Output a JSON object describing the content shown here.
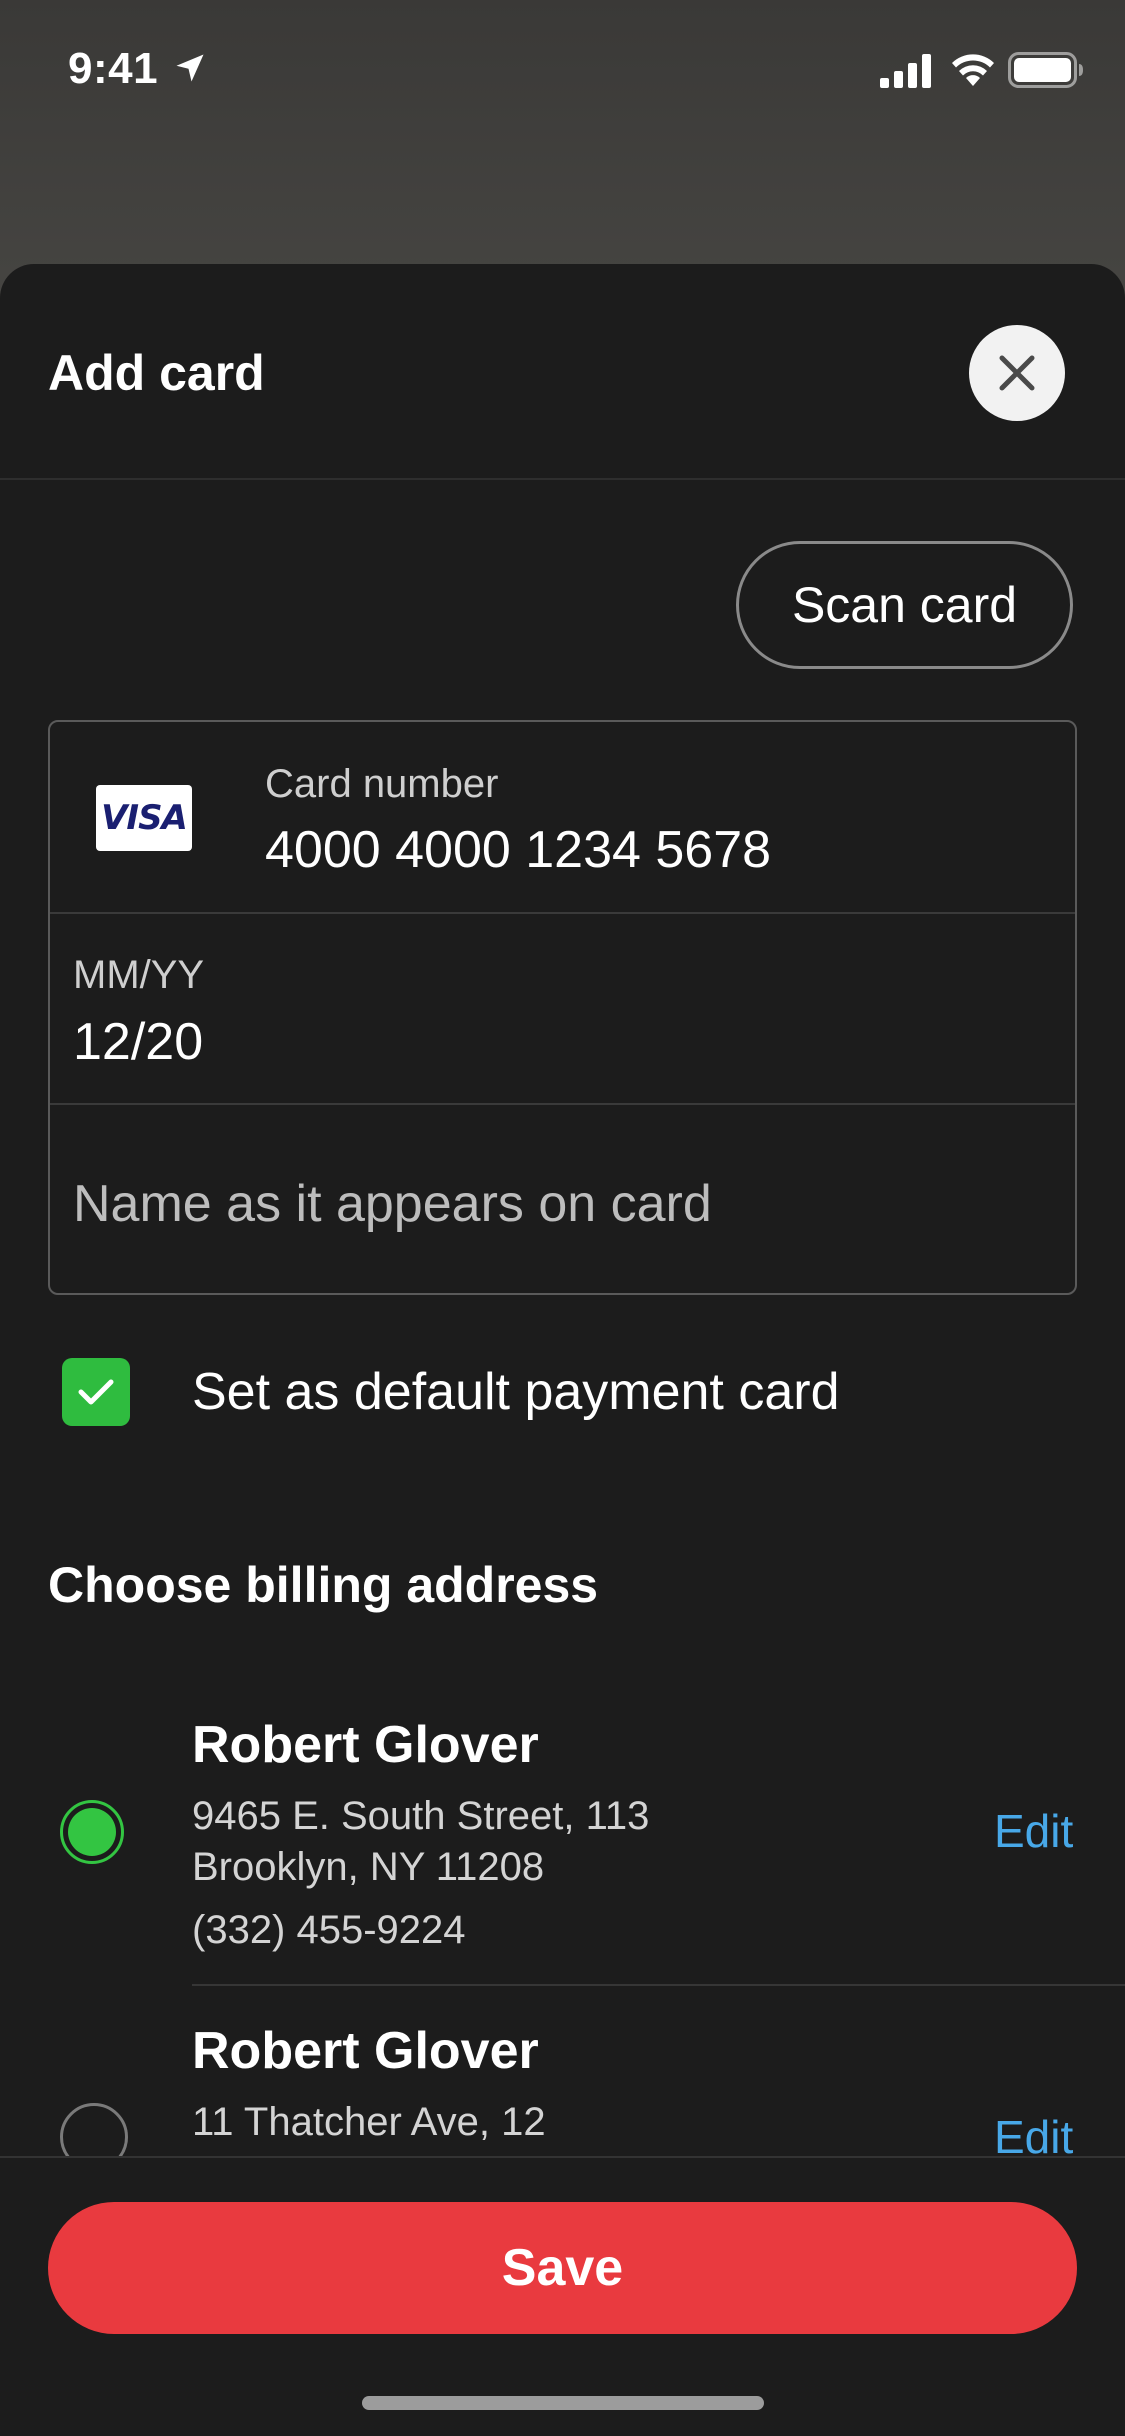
{
  "status_bar": {
    "time": "9:41"
  },
  "sheet": {
    "title": "Add card"
  },
  "scan_card": {
    "label": "Scan card"
  },
  "card_form": {
    "brand": "VISA",
    "card_number_label": "Card number",
    "card_number_value": "4000 4000 1234 5678",
    "expiry_label": "MM/YY",
    "expiry_value": "12/20",
    "name_placeholder": "Name as it appears on card"
  },
  "default_card": {
    "label": "Set as default payment card",
    "checked": true
  },
  "billing": {
    "title": "Choose billing address",
    "addresses": [
      {
        "name": "Robert Glover",
        "line1": "9465 E. South Street, 113",
        "line2": "Brooklyn, NY 11208",
        "phone": "(332) 455-9224",
        "selected": true,
        "edit_label": "Edit"
      },
      {
        "name": "Robert Glover",
        "line1": "11 Thatcher Ave, 12",
        "selected": false,
        "edit_label": "Edit"
      }
    ]
  },
  "save": {
    "label": "Save"
  },
  "colors": {
    "accent_green": "#33c542",
    "save_red": "#e93a3f",
    "link_blue": "#48a8e8",
    "sheet_bg": "#1c1c1c"
  }
}
